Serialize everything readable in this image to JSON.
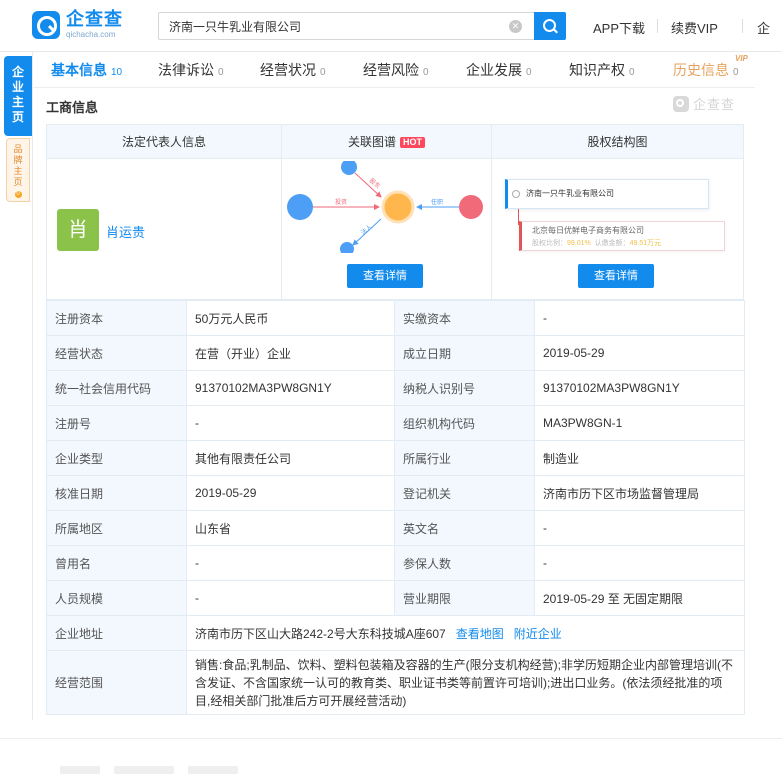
{
  "header": {
    "logo_cn": "企查查",
    "logo_en": "qichacha.com",
    "search_value": "济南一只牛乳业有限公司",
    "links": [
      "APP下载",
      "续费VIP",
      "企"
    ]
  },
  "side": {
    "main_tab": [
      "企",
      "业",
      "主",
      "页"
    ],
    "brand_tab": [
      "品",
      "牌",
      "主",
      "页"
    ],
    "brand_dot": "0"
  },
  "tabs": [
    {
      "label": "基本信息",
      "count": "10"
    },
    {
      "label": "法律诉讼",
      "count": "0"
    },
    {
      "label": "经营状况",
      "count": "0"
    },
    {
      "label": "经营风险",
      "count": "0"
    },
    {
      "label": "企业发展",
      "count": "0"
    },
    {
      "label": "知识产权",
      "count": "0"
    },
    {
      "label": "历史信息",
      "count": "0"
    }
  ],
  "vip_tag": "VIP",
  "section": {
    "title": "工商信息",
    "watermark": "企查查"
  },
  "cards": {
    "legal_rep_title": "法定代表人信息",
    "related_graph_title": "关联图谱",
    "hot_badge": "HOT",
    "equity_title": "股权结构图",
    "avatar_char": "肖",
    "legal_rep_name": "肖运贵",
    "view_detail": "查看详情",
    "graph_labels": {
      "invest": "投资",
      "hold": "任职",
      "shareholder": "股东",
      "law": "法人"
    },
    "equity_company": "济南一只牛乳业有限公司",
    "equity_shareholder": "北京每日优鲜电子商务有限公司",
    "equity_ratio_label": "股权比例：",
    "equity_ratio_value": "99.01%",
    "equity_amount_label": "认缴金额：",
    "equity_amount_value": "49.51万元"
  },
  "info": {
    "reg_capital_label": "注册资本",
    "reg_capital": "50万元人民币",
    "paid_capital_label": "实缴资本",
    "paid_capital": "-",
    "status_label": "经营状态",
    "status": "在营（开业）企业",
    "est_date_label": "成立日期",
    "est_date": "2019-05-29",
    "credit_code_label": "统一社会信用代码",
    "credit_code": "91370102MA3PW8GN1Y",
    "taxpayer_label": "纳税人识别号",
    "taxpayer": "91370102MA3PW8GN1Y",
    "reg_no_label": "注册号",
    "reg_no": "-",
    "org_code_label": "组织机构代码",
    "org_code": "MA3PW8GN-1",
    "type_label": "企业类型",
    "type": "其他有限责任公司",
    "industry_label": "所属行业",
    "industry": "制造业",
    "approve_label": "核准日期",
    "approve_date": "2019-05-29",
    "authority_label": "登记机关",
    "authority": "济南市历下区市场监督管理局",
    "region_label": "所属地区",
    "region": "山东省",
    "en_name_label": "英文名",
    "en_name": "-",
    "former_name_label": "曾用名",
    "former_name": "-",
    "insured_label": "参保人数",
    "insured": "-",
    "staff_label": "人员规模",
    "staff": "-",
    "term_label": "营业期限",
    "term": "2019-05-29 至 无固定期限",
    "address_label": "企业地址",
    "address": "济南市历下区山大路242-2号大东科技城A座607",
    "view_map": "查看地图",
    "nearby": "附近企业",
    "scope_label": "经营范围",
    "scope": "销售:食品;乳制品、饮料、塑料包装箱及容器的生产(限分支机构经营);非学历短期企业内部管理培训(不含发证、不含国家统一认可的教育类、职业证书类等前置许可培训);进出口业务。(依法须经批准的项目,经相关部门批准后方可开展经营活动)"
  },
  "colors": {
    "brand_blue": "#128bed",
    "history_orange": "#e7a35e",
    "hot_red": "#fd485e",
    "avatar_green": "#8bc34a",
    "label_bg": "#f2f8fe"
  }
}
